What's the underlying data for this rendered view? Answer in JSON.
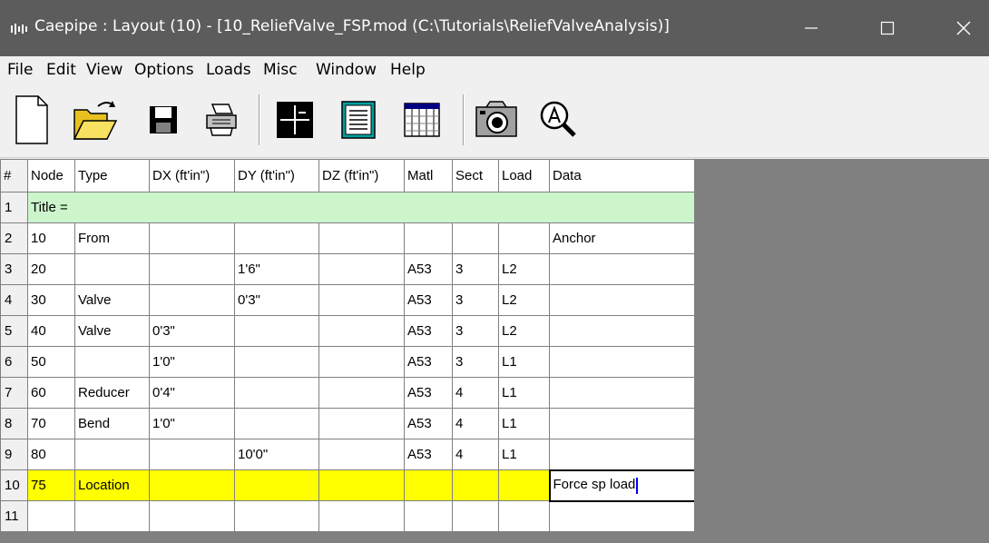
{
  "window": {
    "title": "Caepipe : Layout  (10)  -  [10_ReliefValve_FSP.mod (C:\\Tutorials\\ReliefValveAnalysis)]",
    "icon": "caepipe-app-icon",
    "controls": [
      "minimize-icon",
      "maximize-icon",
      "close-icon"
    ]
  },
  "menu": {
    "items": [
      "File",
      "Edit",
      "View",
      "Options",
      "Loads",
      "Misc",
      "Window",
      "Help"
    ]
  },
  "toolbar": {
    "buttons": [
      "new-file-icon",
      "open-folder-icon",
      "save-disk-icon",
      "print-icon",
      "graphics-crosshair-icon",
      "text-list-icon",
      "table-view-icon",
      "camera-icon",
      "zoom-icon"
    ]
  },
  "grid": {
    "headers": [
      "#",
      "Node",
      "Type",
      "DX (ft'in\")",
      "DY (ft'in\")",
      "DZ (ft'in\")",
      "Matl",
      "Sect",
      "Load",
      "Data"
    ],
    "title_row": {
      "num": "1",
      "text": "Title ="
    },
    "rows": [
      {
        "num": "2",
        "node": "10",
        "type": "From",
        "dx": "",
        "dy": "",
        "dz": "",
        "matl": "",
        "sect": "",
        "load": "",
        "data": "Anchor"
      },
      {
        "num": "3",
        "node": "20",
        "type": "",
        "dx": "",
        "dy": "1'6\"",
        "dz": "",
        "matl": "A53",
        "sect": "3",
        "load": "L2",
        "data": ""
      },
      {
        "num": "4",
        "node": "30",
        "type": "Valve",
        "dx": "",
        "dy": "0'3\"",
        "dz": "",
        "matl": "A53",
        "sect": "3",
        "load": "L2",
        "data": ""
      },
      {
        "num": "5",
        "node": "40",
        "type": "Valve",
        "dx": "0'3\"",
        "dy": "",
        "dz": "",
        "matl": "A53",
        "sect": "3",
        "load": "L2",
        "data": ""
      },
      {
        "num": "6",
        "node": "50",
        "type": "",
        "dx": "1'0\"",
        "dy": "",
        "dz": "",
        "matl": "A53",
        "sect": "3",
        "load": "L1",
        "data": ""
      },
      {
        "num": "7",
        "node": "60",
        "type": "Reducer",
        "dx": "0'4\"",
        "dy": "",
        "dz": "",
        "matl": "A53",
        "sect": "4",
        "load": "L1",
        "data": ""
      },
      {
        "num": "8",
        "node": "70",
        "type": "Bend",
        "dx": "1'0\"",
        "dy": "",
        "dz": "",
        "matl": "A53",
        "sect": "4",
        "load": "L1",
        "data": ""
      },
      {
        "num": "9",
        "node": "80",
        "type": "",
        "dx": "",
        "dy": "10'0\"",
        "dz": "",
        "matl": "A53",
        "sect": "4",
        "load": "L1",
        "data": ""
      },
      {
        "num": "10",
        "node": "75",
        "type": "Location",
        "dx": "",
        "dy": "",
        "dz": "",
        "matl": "",
        "sect": "",
        "load": "",
        "data": "Force sp load"
      },
      {
        "num": "11",
        "node": "",
        "type": "",
        "dx": "",
        "dy": "",
        "dz": "",
        "matl": "",
        "sect": "",
        "load": "",
        "data": ""
      }
    ],
    "selected_row": "10",
    "colors": {
      "title_row": "#ccf5cc",
      "selected_row": "#ffff00",
      "workspace": "#808080"
    }
  }
}
